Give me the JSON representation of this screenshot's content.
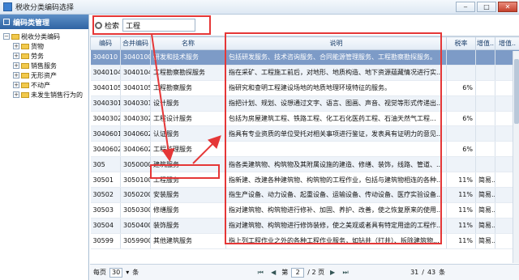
{
  "window": {
    "title": "税收分类编码选择"
  },
  "left": {
    "header": "编码类管理",
    "root": "税收分类编码",
    "nodes": [
      "货物",
      "劳务",
      "销售服务",
      "无形资产",
      "不动产",
      "未发生销售行为的"
    ]
  },
  "search": {
    "label": "检索",
    "value": "工程"
  },
  "columns": [
    "编码",
    "合并编码",
    "名称",
    "说明",
    "税率",
    "增值..",
    "增值.."
  ],
  "rows": [
    {
      "code": "304010",
      "merge": "3040100...",
      "name": "研发和技术服务",
      "desc": "包括研发服务、技术咨询服务、合同能源管理服务、工程勘察勘探服务。",
      "rate": "",
      "z1": "",
      "z2": ""
    },
    {
      "code": "3040104",
      "merge": "3040104...",
      "name": "工程勘察勘探服务",
      "desc": "指在采矿、工程施工前后，对地形、地质构造、地下资源蕴藏情况进行实...",
      "rate": "",
      "z1": "",
      "z2": ""
    },
    {
      "code": "3040105",
      "merge": "3040105...",
      "name": "工程勘察服务",
      "desc": "指研究和查明工程建设场地的地质地理环境特征的服务。",
      "rate": "6%",
      "z1": "",
      "z2": ""
    },
    {
      "code": "3040301",
      "merge": "3040301...",
      "name": "设计服务",
      "desc": "指把计划、规划、设想通过文字、语言、图画、声音、视觉等形式传递出...",
      "rate": "",
      "z1": "",
      "z2": ""
    },
    {
      "code": "3040302",
      "merge": "3040302...",
      "name": "工程设计服务",
      "desc": "包括为房屋建筑工程、铁路工程、化工石化医药工程、石油天然气工程...",
      "rate": "6%",
      "z1": "",
      "z2": ""
    },
    {
      "code": "3040601",
      "merge": "3040602...",
      "name": "认证服务",
      "desc": "指具有专业资质的单位受托对相关事项进行鉴证，发表具有证明力的意见...",
      "rate": "",
      "z1": "",
      "z2": ""
    },
    {
      "code": "3040602",
      "merge": "3040602...",
      "name": "工程监理服务",
      "desc": "",
      "rate": "6%",
      "z1": "",
      "z2": ""
    },
    {
      "code": "305",
      "merge": "3050000...",
      "name": "建筑服务",
      "desc": "指各类建筑物、构筑物及其附属设施的建造、修缮、装饰，线路、管道、...",
      "rate": "",
      "z1": "",
      "z2": ""
    },
    {
      "code": "30501",
      "merge": "3050100...",
      "name": "工程服务",
      "desc": "指新建、改建各种建筑物、构筑物的工程作业，包括与建筑物相连的各种...",
      "rate": "11%",
      "z1": "简易..",
      "z2": ""
    },
    {
      "code": "30502",
      "merge": "3050200...",
      "name": "安装服务",
      "desc": "指生产设备、动力设备、起重设备、运输设备、传动设备、医疗实验设备...",
      "rate": "11%",
      "z1": "简易..",
      "z2": ""
    },
    {
      "code": "30503",
      "merge": "3050300...",
      "name": "修缮服务",
      "desc": "指对建筑物、构筑物进行修补、加固、养护、改善，使之恢复原来的使用...",
      "rate": "11%",
      "z1": "简易..",
      "z2": ""
    },
    {
      "code": "30504",
      "merge": "3050400...",
      "name": "装饰服务",
      "desc": "指对建筑物、构筑物进行修饰装修，使之美观或者具有特定用途的工程作...",
      "rate": "11%",
      "z1": "简易..",
      "z2": ""
    },
    {
      "code": "30599",
      "merge": "3059900...",
      "name": "其他建筑服务",
      "desc": "指上列工程作业之外的各种工程作业服务，如钻井（打井）、拆除建筑物...",
      "rate": "11%",
      "z1": "简易..",
      "z2": ""
    }
  ],
  "pager": {
    "per_page_label": "每页",
    "per_page": "30",
    "unit": "条",
    "page_label": "第",
    "page": "2",
    "of": "/ 2 页",
    "from": "31",
    "to": "43",
    "total_label": "条"
  }
}
